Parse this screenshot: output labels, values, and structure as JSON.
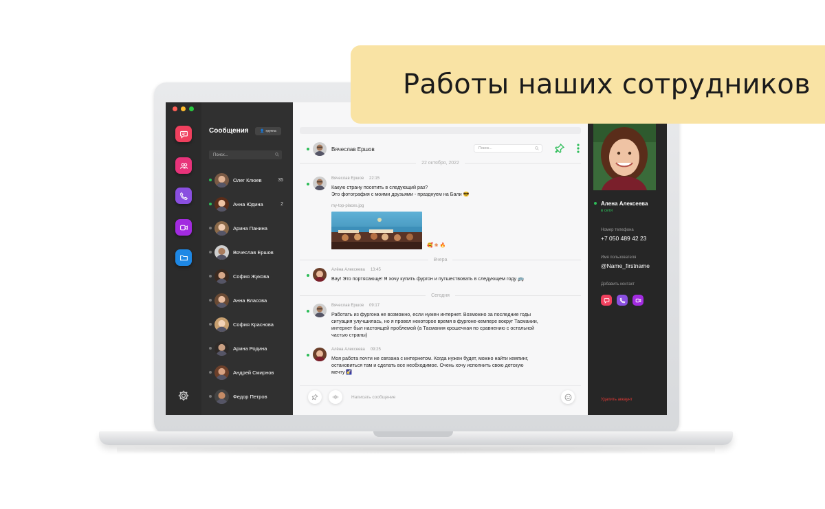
{
  "banner": {
    "title": "Работы наших сотрудников"
  },
  "colors": {
    "accent_green": "#2ebd59",
    "rail_messages": "#f0405e",
    "rail_contacts": "#e8337a",
    "rail_calls": "#8a4fe0",
    "rail_video": "#a22be0",
    "rail_files": "#1e88e5",
    "delete_red": "#e53935",
    "banner_bg": "#f9e3a4"
  },
  "rail": {
    "items": [
      {
        "icon": "chat-bubble-icon"
      },
      {
        "icon": "contacts-icon"
      },
      {
        "icon": "phone-icon"
      },
      {
        "icon": "video-camera-icon"
      },
      {
        "icon": "folder-icon"
      }
    ],
    "settings_icon": "gear-icon"
  },
  "list": {
    "title": "Сообщения",
    "group_button": "группа",
    "search_placeholder": "Поиск...",
    "contacts": [
      {
        "name": "Олег Клюев",
        "count": "35",
        "online": true
      },
      {
        "name": "Анна Юдина",
        "count": "2",
        "online": true
      },
      {
        "name": "Арина Панина",
        "count": "",
        "online": false
      },
      {
        "name": "Вячеслав Ершов",
        "count": "",
        "online": false
      },
      {
        "name": "София Жукова",
        "count": "",
        "online": false
      },
      {
        "name": "Анна Власова",
        "count": "",
        "online": false
      },
      {
        "name": "София Краснова",
        "count": "",
        "online": false
      },
      {
        "name": "Арина Родина",
        "count": "",
        "online": false
      },
      {
        "name": "Андрей Смирнов",
        "count": "",
        "online": false
      },
      {
        "name": "Федор Петров",
        "count": "",
        "online": false
      }
    ]
  },
  "chat": {
    "header_name": "Вячеслав Ершов",
    "search_placeholder": "Поиск...",
    "days": {
      "first": "22 октября, 2022",
      "yesterday": "Вчера",
      "today": "Сегодня"
    },
    "messages": [
      {
        "author": "Вячеслав Ершов",
        "time": "22:15",
        "lines": [
          "Какую страну посетить в следующий раз?",
          "Это фотография с моими друзьями - празднуем на Бали 😎"
        ],
        "attachment": "my-top-places.jpg"
      },
      {
        "author": "Алёна Алексеева",
        "time": "13:45",
        "lines": [
          "Вау! Это портясающе! Я хочу купить фургон и путшествовать в следующем году 🚌"
        ]
      },
      {
        "author": "Вячеслав Ершов",
        "time": "09:17",
        "lines": [
          "Работать из фургона не возможно, если нужен интернет. Возможно за последние годы",
          "ситуация улучшилась, но я провел некоторое время в фургоне-кемпере вокруг Тасмании,",
          "интернет был настоящей проблемой (а Тасмания крошечная по сравнению с остальной",
          "частью страны)"
        ]
      },
      {
        "author": "Алёна Алексеева",
        "time": "09:25",
        "lines": [
          "Моя работа почти не связана с интернетом. Когда нужен будет, можно найти кемпинг,",
          "остановиться там и сделать все необходимое. Очень хочу исполнить свою детскую",
          "мечту 🌠"
        ]
      }
    ],
    "reactions": "🥰 ❀ 🔥",
    "composer_placeholder": "Написать сообщение"
  },
  "profile": {
    "name": "Алена Алексеева",
    "status": "в сети",
    "phone_label": "Номер телефона",
    "phone": "+7 050 489 42 23",
    "username_label": "Имя пользователя",
    "username": "@Name_firstname",
    "add_contact_label": "Добавить контакт",
    "delete_account": "Удалить аккаунт"
  }
}
